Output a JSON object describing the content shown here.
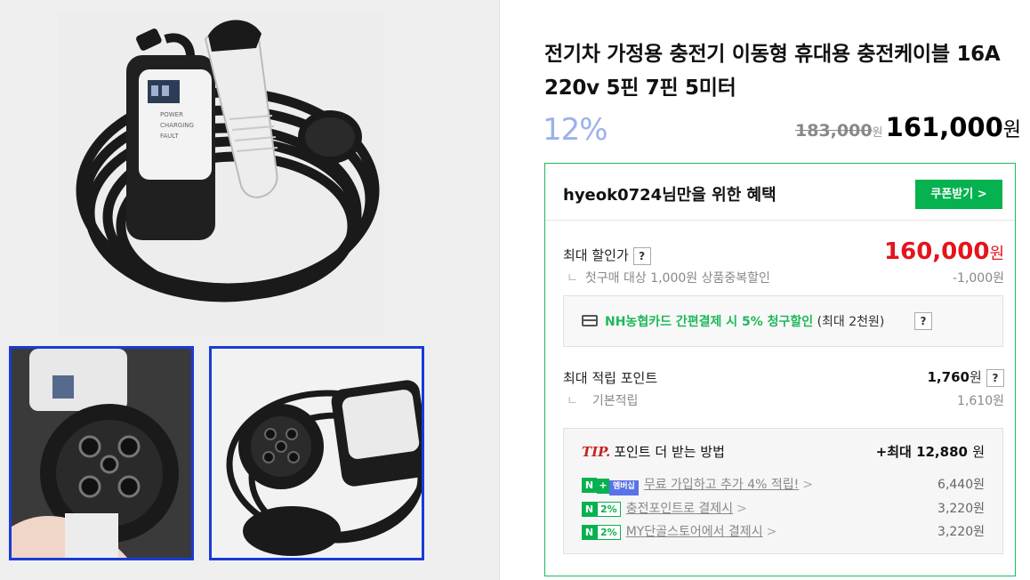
{
  "product": {
    "title": "전기차 가정용 충전기 이동형 휴대용 충전케이블 16A 220v 5핀 7핀 5미터",
    "discount_rate": "12%",
    "original_price": "183,000",
    "final_price": "161,000",
    "won": "원"
  },
  "images": {
    "main": {
      "screen_lines": [
        "POWER",
        "CHARGING",
        "FAULT"
      ]
    },
    "thumbnails": [
      "thumb-connector-closeup",
      "thumb-charger-cable"
    ]
  },
  "benefit": {
    "title": "hyeok0724님만을 위한 혜택",
    "coupon_button": "쿠폰받기 >",
    "max_discount_label": "최대 할인가",
    "max_discount_price": "160,000",
    "first_purchase_label": "첫구매 대상 1,000원 상품중복할인",
    "first_purchase_value": "-1,000원",
    "card_green": "NH농협카드 간편결제 시 5% 청구할인",
    "card_grey": " (최대 2천원)",
    "points_label": "최대 적립 포인트",
    "points_value": "1,760",
    "basic_label": "기본적립",
    "basic_value": "1,610원",
    "help": "?",
    "tick": "ㄴ"
  },
  "tip": {
    "tip_word": "TIP.",
    "title": "포인트 더 받는 방법",
    "max_prefix": "+최대 ",
    "max_value": "12,880",
    "rows": [
      {
        "badge_n": "N",
        "badge_plus": "+",
        "badge_member": "멤버십",
        "text": "무료 가입하고 추가 4% 적립!",
        "amount": "6,440원"
      },
      {
        "badge_n": "N",
        "badge_pct": "2%",
        "text": "충전포인트로 결제시",
        "amount": "3,220원"
      },
      {
        "badge_n": "N",
        "badge_pct": "2%",
        "text": "MY단골스토어에서 결제시",
        "amount": "3,220원"
      }
    ],
    "chevron": ">"
  },
  "colors": {
    "accent_green": "#06b14f",
    "price_red": "#e4141c",
    "thumb_border": "#1a3bd6",
    "rate_blue": "#9bb2ea"
  }
}
